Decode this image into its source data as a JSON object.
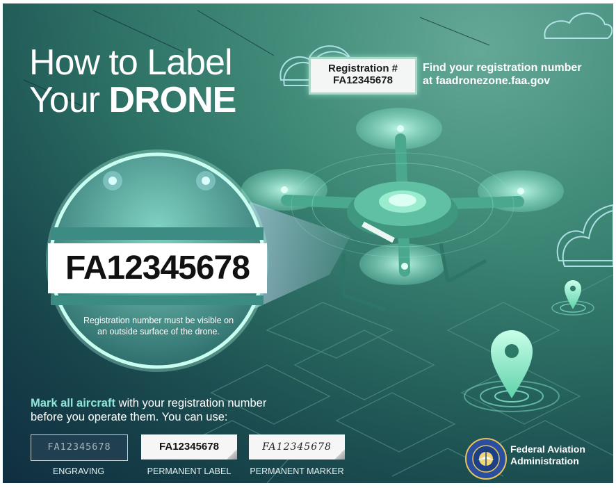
{
  "title": {
    "line1": "How to Label",
    "line2_prefix": "Your ",
    "line2_bold": "DRONE"
  },
  "registration_box": {
    "label": "Registration #",
    "number": "FA12345678"
  },
  "find": {
    "line1": "Find your registration number",
    "line2": "at faadronezone.faa.gov"
  },
  "zoom": {
    "number": "FA12345678",
    "note_line1": "Registration number must be visible on",
    "note_line2": "an outside surface of the drone."
  },
  "drone_label_text": "FA12345678",
  "mark": {
    "highlight": "Mark all aircraft",
    "line1_rest": " with your registration number",
    "line2": "before you operate them. You can use:"
  },
  "options": [
    {
      "sample": "FA12345678",
      "caption": "ENGRAVING"
    },
    {
      "sample": "FA12345678",
      "caption": "PERMANENT LABEL"
    },
    {
      "sample": "FA12345678",
      "caption": "PERMANENT MARKER"
    }
  ],
  "faa": {
    "line1": "Federal Aviation",
    "line2": "Administration",
    "seal_top": "FEDERAL AVIATION",
    "seal_bottom": "ADMINISTRATION"
  },
  "colors": {
    "background": "#2b6f63",
    "accent": "#8fe6d7",
    "glow": "#a9f0dc"
  }
}
